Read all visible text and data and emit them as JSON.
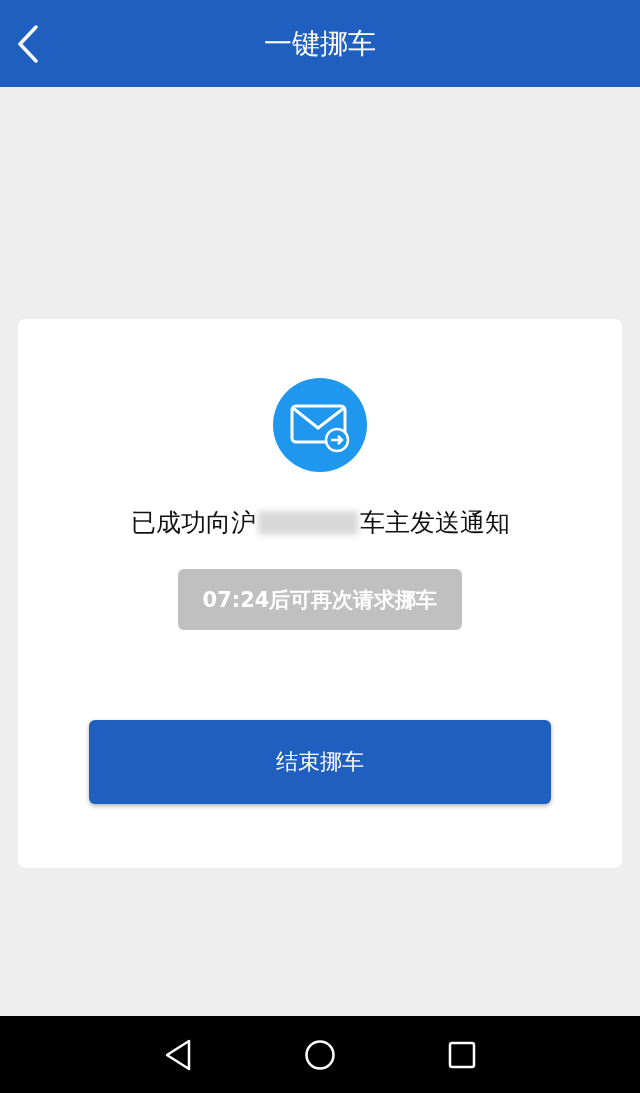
{
  "header": {
    "title": "一键挪车"
  },
  "notice": {
    "text_before": "已成功向沪",
    "text_after": "车主发送通知"
  },
  "countdown": {
    "text": "07:24后可再次请求挪车",
    "disabled": true
  },
  "button": {
    "label": "结束挪车"
  }
}
